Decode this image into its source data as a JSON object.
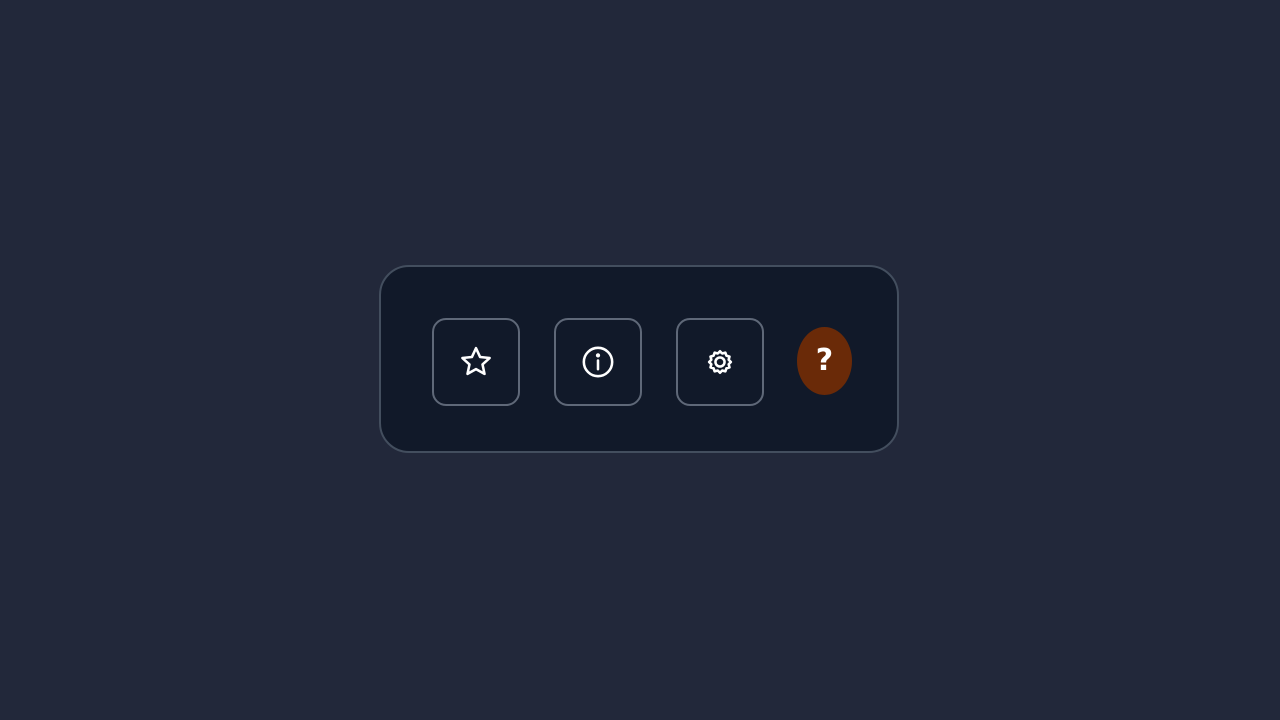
{
  "toolbar": {
    "buttons": [
      {
        "icon": "star-icon"
      },
      {
        "icon": "info-icon"
      },
      {
        "icon": "gear-icon"
      }
    ],
    "help": {
      "label": "?",
      "color": "#6a2a08"
    }
  }
}
